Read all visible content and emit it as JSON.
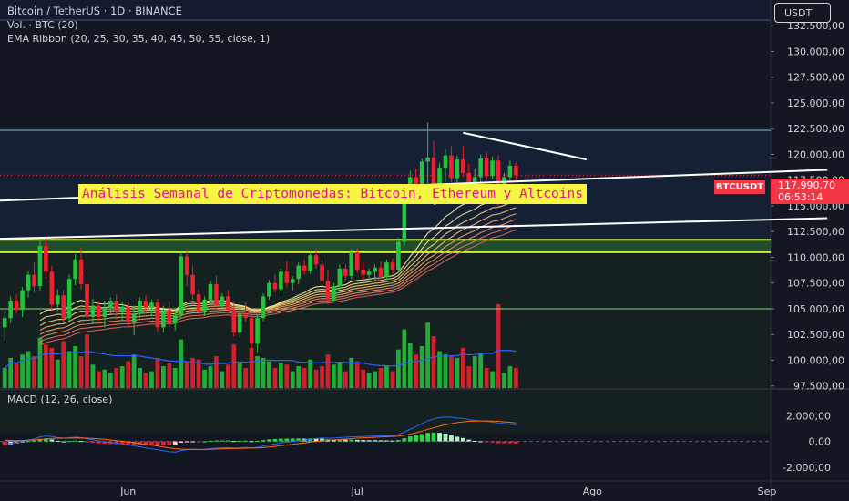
{
  "header": {
    "title": "Bitcoin / TetherUS · 1D · BINANCE",
    "volume_label": "Vol. · BTC (20)",
    "ribbon_label": "EMA Ribbon (20, 25, 30, 35, 40, 45, 50, 55, close, 1)",
    "currency": "USDT"
  },
  "banner": {
    "text": "Análisis Semanal de Criptomonedas: Bitcoin, Ethereum y Altcoins"
  },
  "price_tag": {
    "symbol": "BTCUSDT",
    "price": "117.990,70",
    "countdown": "06:53:14"
  },
  "macd": {
    "label": "MACD (12, 26, close)"
  },
  "colors": {
    "up": "#22c53a",
    "down": "#f0202e",
    "macd_line": "#2962ff",
    "signal_line": "#ff6d00",
    "zone_fill": "#1f3a22",
    "zone_border": "#d4f034",
    "hline": "#89bfe0"
  },
  "chart_data": {
    "type": "candlestick",
    "price_axis": {
      "ticks": [
        {
          "v": 132500,
          "label": "132.500,00"
        },
        {
          "v": 130000,
          "label": "130.000,00"
        },
        {
          "v": 127500,
          "label": "127.500,00"
        },
        {
          "v": 125000,
          "label": "125.000,00"
        },
        {
          "v": 122500,
          "label": "122.500,00"
        },
        {
          "v": 120000,
          "label": "120.000,00"
        },
        {
          "v": 117500,
          "label": "117.500,00"
        },
        {
          "v": 115000,
          "label": "115.000,00"
        },
        {
          "v": 112500,
          "label": "112.500,00"
        },
        {
          "v": 110000,
          "label": "110.000,00"
        },
        {
          "v": 107500,
          "label": "107.500,00"
        },
        {
          "v": 105000,
          "label": "105.000,00"
        },
        {
          "v": 102500,
          "label": "102.500,00"
        },
        {
          "v": 100000,
          "label": "100.000,00"
        },
        {
          "v": 97500,
          "label": "97.500,00"
        }
      ],
      "range": [
        97300,
        135000
      ]
    },
    "macd_axis": {
      "ticks": [
        {
          "v": 2000,
          "label": "2.000,00"
        },
        {
          "v": 0,
          "label": "0,00"
        },
        {
          "v": -2000,
          "label": "-2.000,00"
        }
      ],
      "range": [
        -3000,
        4000
      ]
    },
    "time_axis": [
      "Jun",
      "Jul",
      "Ago",
      "Sep"
    ],
    "time_tick_index": [
      21,
      60,
      100,
      140
    ],
    "last_price": 117990.7,
    "zone": {
      "low": 110500,
      "high": 111700
    },
    "horizontal_lines": [
      122350,
      105000,
      111000,
      112000
    ],
    "trendlines": [
      {
        "from": [
          -1,
          115500
        ],
        "to": [
          140,
          118500
        ]
      },
      {
        "from": [
          -1,
          111800
        ],
        "to": [
          140,
          113800
        ]
      },
      {
        "from": [
          78,
          122100
        ],
        "to": [
          99,
          119500
        ]
      },
      {
        "from": [
          73,
          115200
        ],
        "to": [
          86,
          116800
        ]
      }
    ],
    "candles": [
      [
        103200,
        104800,
        101900,
        104100
      ],
      [
        104100,
        106200,
        103600,
        105800
      ],
      [
        105800,
        106400,
        104500,
        104900
      ],
      [
        104900,
        107100,
        104200,
        106800
      ],
      [
        106800,
        108600,
        106100,
        108300
      ],
      [
        108300,
        109500,
        106600,
        107200
      ],
      [
        107200,
        111700,
        106800,
        111100
      ],
      [
        111100,
        111900,
        108000,
        108600
      ],
      [
        108600,
        109200,
        104700,
        105400
      ],
      [
        105400,
        106900,
        104800,
        106300
      ],
      [
        106300,
        106800,
        103600,
        104100
      ],
      [
        104100,
        108300,
        103800,
        107900
      ],
      [
        107900,
        110300,
        107300,
        109800
      ],
      [
        109800,
        111000,
        106900,
        107400
      ],
      [
        107400,
        108600,
        103600,
        104200
      ],
      [
        104200,
        106000,
        103500,
        105300
      ],
      [
        105300,
        105700,
        103800,
        104200
      ],
      [
        104200,
        105800,
        103200,
        105100
      ],
      [
        105100,
        106100,
        104500,
        105800
      ],
      [
        105800,
        106400,
        104000,
        104700
      ],
      [
        104700,
        105700,
        103900,
        105200
      ],
      [
        105200,
        105600,
        103300,
        103700
      ],
      [
        103700,
        105300,
        102400,
        104500
      ],
      [
        104500,
        106100,
        104100,
        105800
      ],
      [
        105800,
        106300,
        104600,
        105100
      ],
      [
        105100,
        105900,
        104300,
        105600
      ],
      [
        105600,
        106000,
        102800,
        103200
      ],
      [
        103200,
        105300,
        102700,
        104900
      ],
      [
        104900,
        105700,
        103200,
        103600
      ],
      [
        103600,
        104900,
        102900,
        104400
      ],
      [
        104400,
        110500,
        104100,
        110100
      ],
      [
        110100,
        110800,
        107200,
        108300
      ],
      [
        108300,
        109200,
        105900,
        106400
      ],
      [
        106400,
        106900,
        104300,
        104700
      ],
      [
        104700,
        106200,
        104300,
        105900
      ],
      [
        105900,
        107700,
        105600,
        107400
      ],
      [
        107400,
        108200,
        104800,
        105300
      ],
      [
        105300,
        106500,
        104800,
        106200
      ],
      [
        106200,
        106800,
        104500,
        104900
      ],
      [
        104900,
        105400,
        102300,
        102700
      ],
      [
        102700,
        104800,
        102200,
        104500
      ],
      [
        104500,
        105600,
        103700,
        104100
      ],
      [
        104100,
        104600,
        101100,
        101600
      ],
      [
        101600,
        104400,
        100800,
        104100
      ],
      [
        104100,
        106500,
        103800,
        106200
      ],
      [
        106200,
        107800,
        105900,
        107500
      ],
      [
        107500,
        108300,
        106600,
        106900
      ],
      [
        106900,
        108900,
        106400,
        108600
      ],
      [
        108600,
        109600,
        107100,
        107500
      ],
      [
        107500,
        108200,
        106800,
        107900
      ],
      [
        107900,
        109500,
        107400,
        109200
      ],
      [
        109200,
        109800,
        108300,
        108700
      ],
      [
        108700,
        110500,
        108400,
        110200
      ],
      [
        110200,
        110900,
        108900,
        109300
      ],
      [
        109300,
        109700,
        107300,
        107700
      ],
      [
        107700,
        108800,
        105400,
        105900
      ],
      [
        105900,
        107500,
        105600,
        107200
      ],
      [
        107200,
        109300,
        106800,
        108900
      ],
      [
        108900,
        109300,
        107800,
        108200
      ],
      [
        108200,
        110800,
        107900,
        110500
      ],
      [
        110500,
        110900,
        108500,
        108800
      ],
      [
        108800,
        109500,
        107800,
        108300
      ],
      [
        108300,
        108900,
        107600,
        108600
      ],
      [
        108600,
        109300,
        107800,
        109000
      ],
      [
        109000,
        109600,
        107600,
        108100
      ],
      [
        108100,
        109800,
        107800,
        109500
      ],
      [
        109500,
        109900,
        108300,
        108800
      ],
      [
        108800,
        111900,
        108500,
        111500
      ],
      [
        111500,
        116900,
        111100,
        116500
      ],
      [
        116500,
        118400,
        116100,
        117800
      ],
      [
        117800,
        118600,
        116400,
        117100
      ],
      [
        117100,
        119600,
        116800,
        119300
      ],
      [
        119300,
        123100,
        117200,
        119700
      ],
      [
        119700,
        121300,
        115800,
        116800
      ],
      [
        116800,
        119200,
        116000,
        118700
      ],
      [
        118700,
        120500,
        117300,
        119900
      ],
      [
        119900,
        120800,
        117300,
        117700
      ],
      [
        117700,
        119900,
        117200,
        119500
      ],
      [
        119500,
        120800,
        117800,
        118200
      ],
      [
        118200,
        119100,
        116300,
        117300
      ],
      [
        117300,
        118600,
        116400,
        117800
      ],
      [
        117800,
        120000,
        117200,
        119600
      ],
      [
        119600,
        120200,
        117500,
        117900
      ],
      [
        117900,
        119800,
        117600,
        119400
      ],
      [
        119400,
        119900,
        114800,
        115400
      ],
      [
        115400,
        118200,
        115000,
        117800
      ],
      [
        117800,
        119400,
        117300,
        118900
      ],
      [
        118900,
        119200,
        117400,
        117990
      ]
    ],
    "volumes": [
      1.2,
      1.8,
      1.5,
      2.0,
      2.2,
      1.9,
      3.0,
      2.6,
      2.4,
      1.7,
      2.8,
      2.2,
      2.5,
      1.9,
      3.2,
      1.4,
      1.0,
      1.1,
      0.9,
      1.2,
      1.3,
      1.6,
      2.0,
      1.2,
      0.9,
      1.0,
      1.8,
      1.3,
      1.5,
      1.2,
      2.9,
      1.6,
      1.8,
      1.7,
      1.1,
      1.3,
      1.9,
      1.0,
      1.4,
      2.6,
      1.5,
      1.2,
      2.4,
      1.9,
      1.8,
      1.6,
      1.2,
      1.5,
      1.4,
      1.0,
      1.3,
      1.2,
      1.7,
      1.1,
      1.3,
      2.0,
      1.4,
      1.5,
      1.0,
      1.8,
      1.6,
      1.1,
      0.9,
      1.0,
      1.2,
      1.3,
      1.0,
      2.3,
      3.5,
      2.7,
      2.0,
      2.5,
      3.9,
      3.1,
      2.2,
      2.0,
      1.9,
      1.8,
      2.4,
      1.3,
      1.9,
      2.1,
      1.2,
      1.0,
      5.0,
      0.9,
      1.3,
      1.2
    ],
    "macd": {
      "macd_line": [
        -200,
        -150,
        -80,
        20,
        120,
        180,
        350,
        420,
        380,
        300,
        250,
        280,
        330,
        300,
        200,
        120,
        50,
        -20,
        -80,
        -140,
        -200,
        -260,
        -330,
        -420,
        -500,
        -570,
        -650,
        -720,
        -800,
        -830,
        -700,
        -640,
        -620,
        -640,
        -620,
        -560,
        -520,
        -500,
        -480,
        -520,
        -500,
        -470,
        -500,
        -460,
        -380,
        -280,
        -200,
        -120,
        -60,
        0,
        60,
        100,
        180,
        230,
        260,
        240,
        260,
        300,
        320,
        360,
        370,
        380,
        400,
        420,
        430,
        440,
        450,
        520,
        720,
        950,
        1150,
        1380,
        1600,
        1750,
        1850,
        1900,
        1880,
        1820,
        1780,
        1700,
        1620,
        1600,
        1550,
        1500,
        1420,
        1380,
        1330,
        1280
      ],
      "signal_line": [
        100,
        80,
        60,
        70,
        90,
        110,
        150,
        200,
        230,
        250,
        250,
        255,
        265,
        270,
        255,
        230,
        200,
        160,
        110,
        60,
        10,
        -40,
        -100,
        -160,
        -230,
        -300,
        -370,
        -440,
        -510,
        -570,
        -600,
        -610,
        -615,
        -620,
        -620,
        -610,
        -595,
        -575,
        -555,
        -550,
        -540,
        -525,
        -520,
        -505,
        -480,
        -440,
        -390,
        -335,
        -280,
        -225,
        -170,
        -115,
        -55,
        0,
        50,
        90,
        120,
        155,
        185,
        220,
        250,
        275,
        300,
        325,
        345,
        365,
        385,
        410,
        470,
        560,
        670,
        800,
        930,
        1060,
        1180,
        1290,
        1380,
        1460,
        1520,
        1560,
        1580,
        1590,
        1590,
        1580,
        1560,
        1520,
        1480,
        1440
      ]
    }
  }
}
